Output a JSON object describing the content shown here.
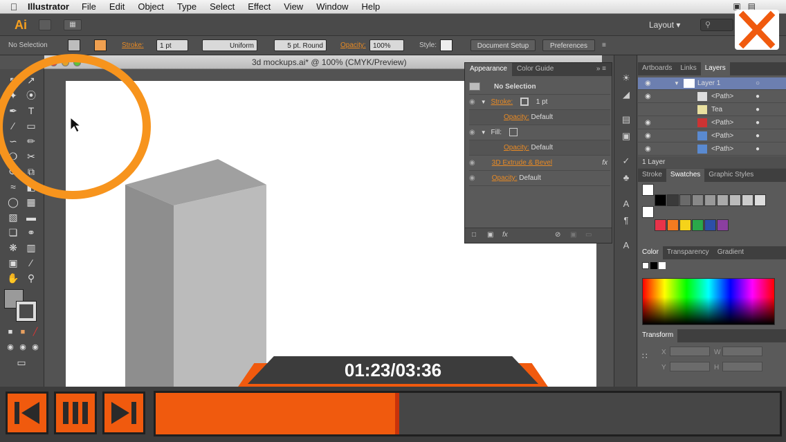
{
  "menubar": {
    "app_name": "Illustrator",
    "items": [
      "File",
      "Edit",
      "Object",
      "Type",
      "Select",
      "Effect",
      "View",
      "Window",
      "Help"
    ]
  },
  "appbar": {
    "logo": "Ai",
    "workspace": "Layout"
  },
  "controlbar": {
    "selection": "No Selection",
    "stroke_label": "Stroke:",
    "stroke_weight": "1 pt",
    "profile": "Uniform",
    "brush": "5 pt. Round",
    "opacity_label": "Opacity:",
    "opacity_value": "100%",
    "style_label": "Style:",
    "document_setup": "Document Setup",
    "preferences": "Preferences"
  },
  "document": {
    "title": "3d mockups.ai* @ 100% (CMYK/Preview)"
  },
  "appearance_panel": {
    "tabs": [
      "Appearance",
      "Color Guide"
    ],
    "header": "No Selection",
    "stroke_label": "Stroke:",
    "stroke_value": "1 pt",
    "stroke_opacity_label": "Opacity:",
    "stroke_opacity_value": "Default",
    "fill_label": "Fill:",
    "fill_opacity_label": "Opacity:",
    "fill_opacity_value": "Default",
    "effect": "3D Extrude & Bevel",
    "opacity_label": "Opacity:",
    "opacity_value": "Default",
    "fx": "fx"
  },
  "layers_panel": {
    "tabs": [
      "Artboards",
      "Links",
      "Layers"
    ],
    "rows": [
      "Layer 1",
      "<Path>",
      "Tea",
      "<Path>",
      "<Path>",
      "<Path>"
    ],
    "footer": "1 Layer"
  },
  "swatches_panel": {
    "tabs": [
      "Stroke",
      "Swatches",
      "Graphic Styles"
    ]
  },
  "color_panel": {
    "tabs": [
      "Color",
      "Transparency",
      "Gradient"
    ]
  },
  "transform_panel": {
    "title": "Transform",
    "labels": [
      "X",
      "Y",
      "W",
      "H"
    ]
  },
  "player": {
    "time": "01:23/03:36",
    "progress": 0.39
  },
  "colors": {
    "accent_orange": "#f05a0e",
    "highlight_orange": "#f7941d"
  }
}
